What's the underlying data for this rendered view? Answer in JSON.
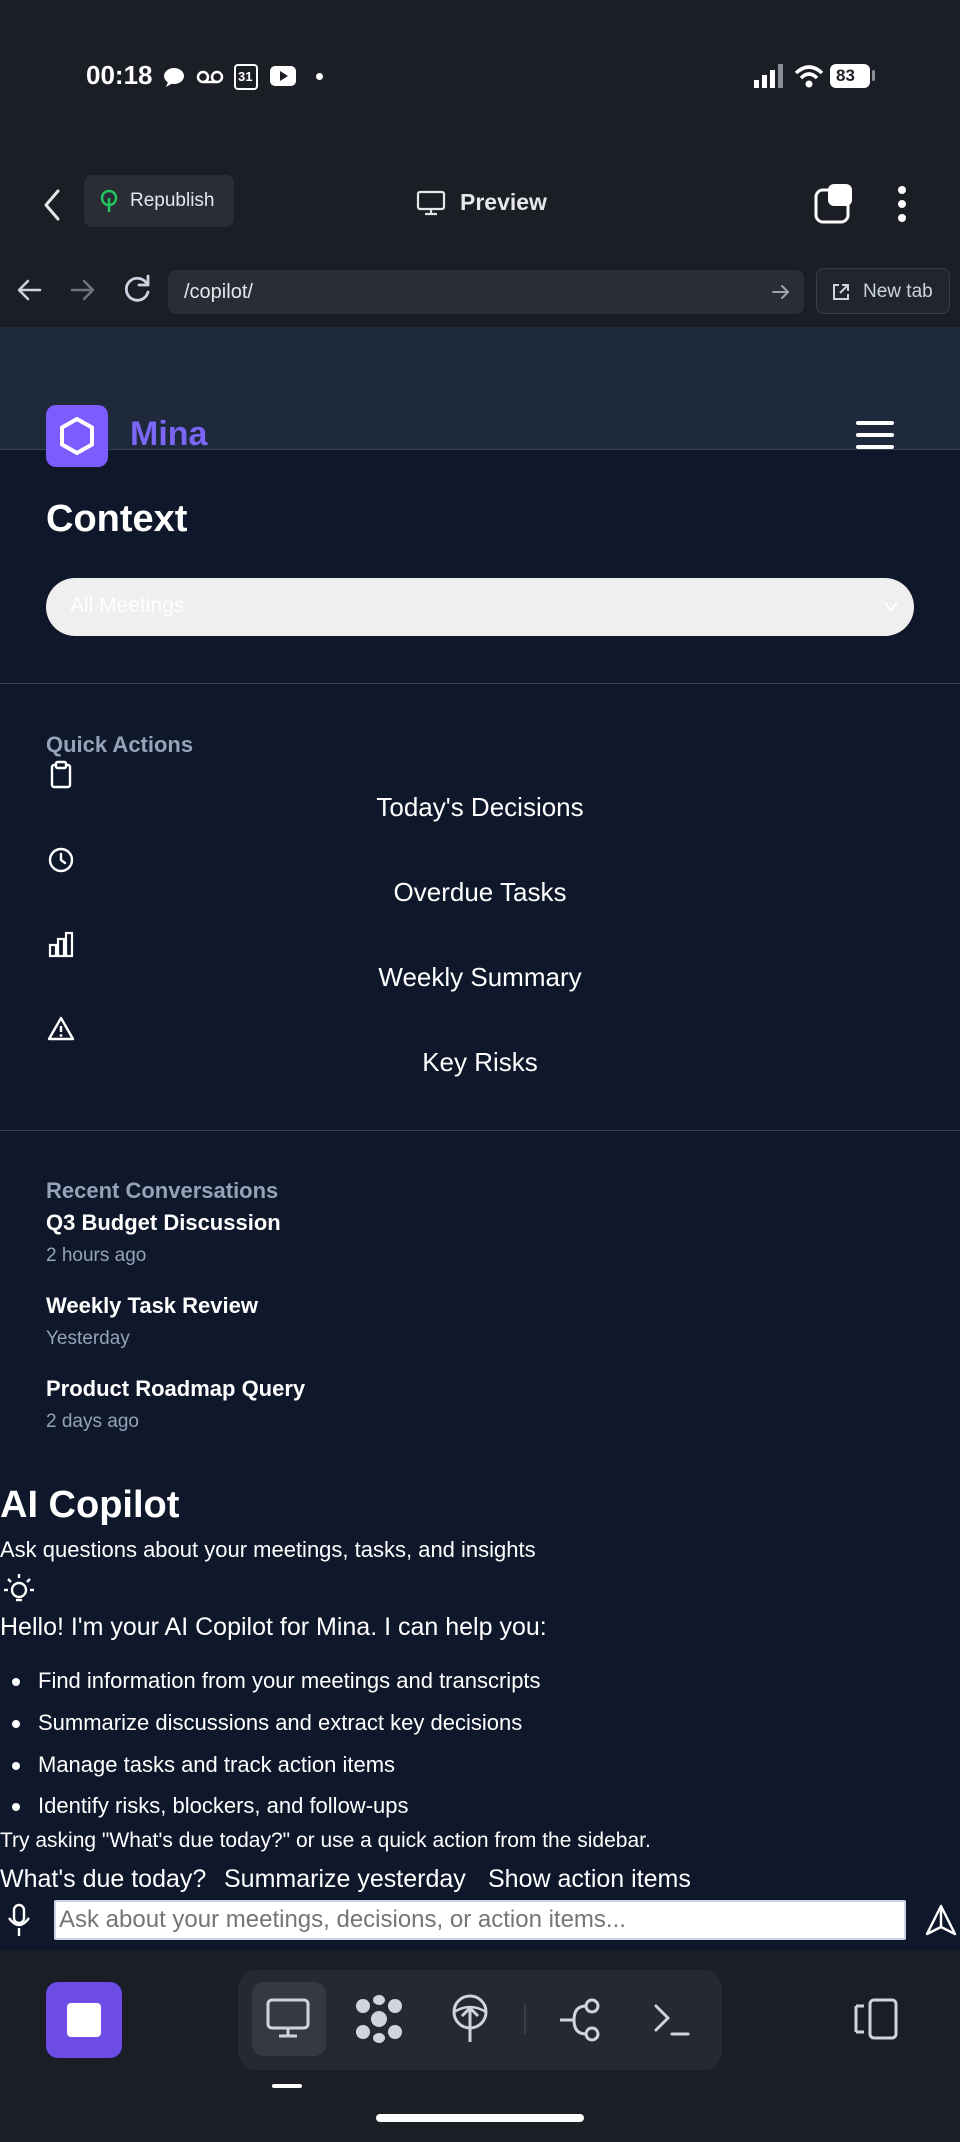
{
  "status_bar": {
    "time": "00:18",
    "calendar_day": "31",
    "battery": "83"
  },
  "app_header": {
    "republish_label": "Republish",
    "preview_label": "Preview"
  },
  "browser_bar": {
    "url": "/copilot/",
    "new_tab_label": "New tab"
  },
  "site": {
    "brand": "Mina"
  },
  "context": {
    "title": "Context",
    "select_value": "All Meetings"
  },
  "quick_actions": {
    "label": "Quick Actions",
    "items": [
      {
        "label": "Today's Decisions",
        "icon": "clipboard-icon"
      },
      {
        "label": "Overdue Tasks",
        "icon": "clock-icon"
      },
      {
        "label": "Weekly Summary",
        "icon": "bar-chart-icon"
      },
      {
        "label": "Key Risks",
        "icon": "warning-icon"
      }
    ]
  },
  "recent_conversations": {
    "label": "Recent Conversations",
    "items": [
      {
        "title": "Q3 Budget Discussion",
        "time": "2 hours ago"
      },
      {
        "title": "Weekly Task Review",
        "time": "Yesterday"
      },
      {
        "title": "Product Roadmap Query",
        "time": "2 days ago"
      }
    ]
  },
  "copilot": {
    "title": "AI Copilot",
    "subtitle": "Ask questions about your meetings, tasks, and insights",
    "greeting": "Hello! I'm your AI Copilot for Mina. I can help you:",
    "capabilities": [
      "Find information from your meetings and transcripts",
      "Summarize discussions and extract key decisions",
      "Manage tasks and track action items",
      "Identify risks, blockers, and follow-ups"
    ],
    "tip": "Try asking \"What's due today?\" or use a quick action from the sidebar.",
    "suggestions": [
      "What's due today?",
      "Summarize yesterday",
      "Show action items"
    ],
    "input_placeholder": "Ask about your meetings, decisions, or action items..."
  },
  "colors": {
    "page_bg": "#0f172a",
    "header_band": "#1e293b",
    "brand_accent": "#7c66f7",
    "chrome_bg": "#1c1e26",
    "stop_button": "#6d4ce8"
  }
}
